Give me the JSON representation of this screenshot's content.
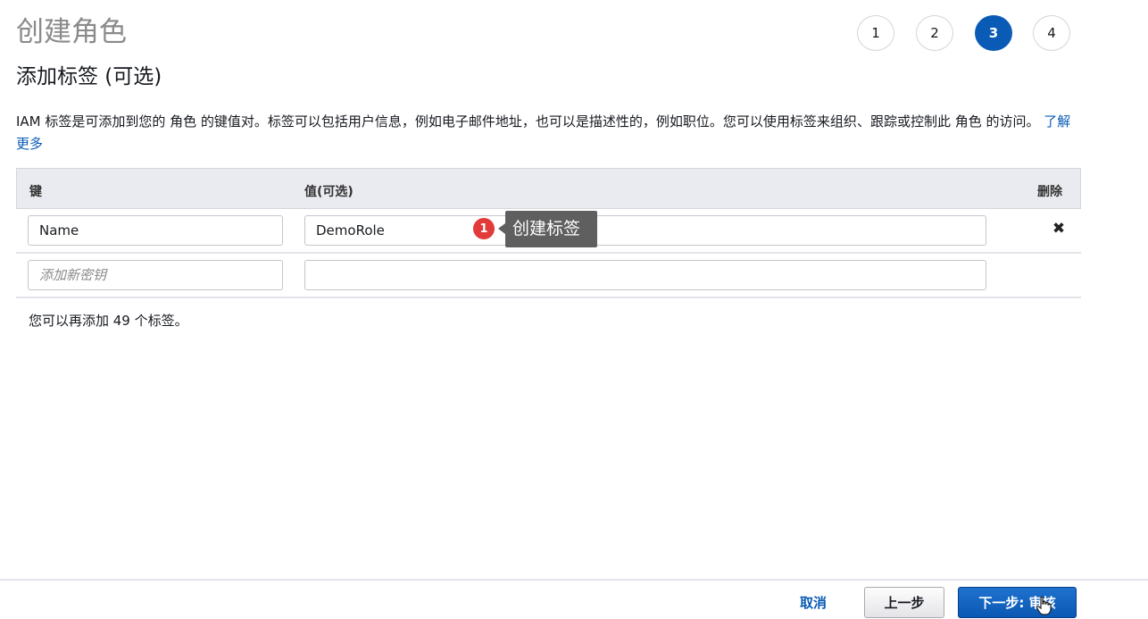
{
  "page": {
    "title": "创建角色"
  },
  "steps": [
    {
      "label": "1"
    },
    {
      "label": "2"
    },
    {
      "label": "3",
      "active": true
    },
    {
      "label": "4"
    }
  ],
  "section": {
    "title": "添加标签 (可选)",
    "description": "IAM 标签是可添加到您的 角色 的键值对。标签可以包括用户信息，例如电子邮件地址，也可以是描述性的，例如职位。您可以使用标签来组织、跟踪或控制此 角色 的访问。",
    "learn_more": "了解更多"
  },
  "table": {
    "headers": {
      "key": "键",
      "value": "值(可选)",
      "remove": "删除"
    },
    "rows": [
      {
        "key": "Name",
        "value": "DemoRole"
      }
    ],
    "new_row": {
      "key_placeholder": "添加新密钥",
      "value": ""
    }
  },
  "tag_remaining": "您可以再添加 49 个标签。",
  "callout": {
    "badge": "1",
    "text": "创建标签"
  },
  "footer": {
    "cancel": "取消",
    "previous": "上一步",
    "next": "下一步: 审核"
  },
  "colors": {
    "primary": "#0a5bb5",
    "badge": "#e23b3b"
  }
}
